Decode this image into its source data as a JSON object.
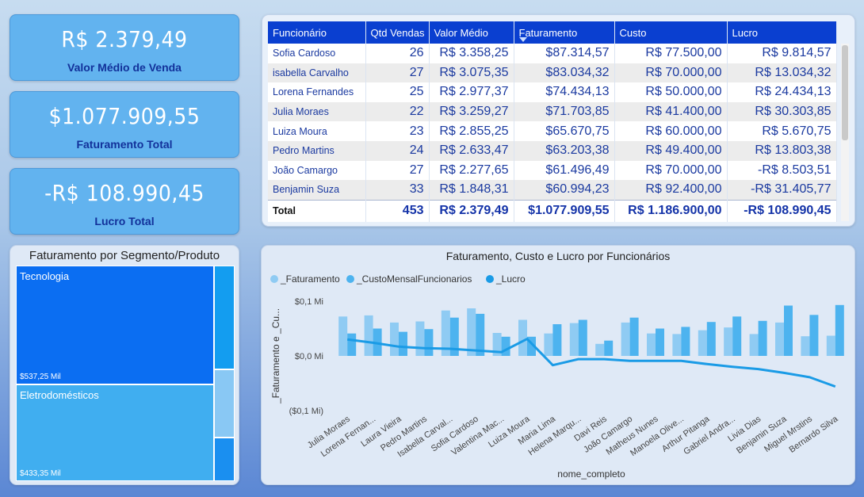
{
  "kpis": {
    "avg_sale": {
      "value": "R$ 2.379,49",
      "label": "Valor Médio de Venda"
    },
    "revenue": {
      "value": "$1.077.909,55",
      "label": "Faturamento Total"
    },
    "profit": {
      "value": "-R$ 108.990,45",
      "label": "Lucro Total"
    }
  },
  "table": {
    "columns": [
      "Funcionário",
      "Qtd Vendas",
      "Valor Médio",
      "Faturamento",
      "Custo",
      "Lucro"
    ],
    "rows": [
      [
        "Sofia Cardoso",
        "26",
        "R$ 3.358,25",
        "$87.314,57",
        "R$ 77.500,00",
        "R$ 9.814,57"
      ],
      [
        "isabella Carvalho",
        "27",
        "R$ 3.075,35",
        "$83.034,32",
        "R$ 70.000,00",
        "R$ 13.034,32"
      ],
      [
        "Lorena Fernandes",
        "25",
        "R$ 2.977,37",
        "$74.434,13",
        "R$ 50.000,00",
        "R$ 24.434,13"
      ],
      [
        "Julia Moraes",
        "22",
        "R$ 3.259,27",
        "$71.703,85",
        "R$ 41.400,00",
        "R$ 30.303,85"
      ],
      [
        "Luiza Moura",
        "23",
        "R$ 2.855,25",
        "$65.670,75",
        "R$ 60.000,00",
        "R$ 5.670,75"
      ],
      [
        "Pedro Martins",
        "24",
        "R$ 2.633,47",
        "$63.203,38",
        "R$ 49.400,00",
        "R$ 13.803,38"
      ],
      [
        "João Camargo",
        "27",
        "R$ 2.277,65",
        "$61.496,49",
        "R$ 70.000,00",
        "-R$ 8.503,51"
      ],
      [
        "Benjamin Suza",
        "33",
        "R$ 1.848,31",
        "$60.994,23",
        "R$ 92.400,00",
        "-R$ 31.405,77"
      ]
    ],
    "total": [
      "Total",
      "453",
      "R$ 2.379,49",
      "$1.077.909,55",
      "R$ 1.186.900,00",
      "-R$ 108.990,45"
    ]
  },
  "treemap": {
    "title": "Faturamento por Segmento/Produto",
    "tiles": [
      {
        "name": "Tecnologia",
        "value": "$537,25 Mil"
      },
      {
        "name": "Eletrodomésticos",
        "value": "$433,35 Mil"
      }
    ]
  },
  "chart_data": {
    "type": "bar",
    "title": "Faturamento, Custo e Lucro por Funcionários",
    "xlabel": "nome_completo",
    "ylabel": "_Faturamento e _Cu...",
    "ylim": [
      -0.1,
      0.1
    ],
    "yticks": [
      "$0,1 Mi",
      "$0,0 Mi",
      "($0,1 Mi)"
    ],
    "ytick_values": [
      0.1,
      0.0,
      -0.1
    ],
    "categories": [
      "Julia Moraes",
      "Lorena Fernan...",
      "Laura Vieira",
      "Pedro Martins",
      "Isabella Carval...",
      "Sofia Cardoso",
      "Valentina Mac...",
      "Luiza Moura",
      "Maria Lima",
      "Helena Marqu...",
      "Davi Reis",
      "João Camargo",
      "Matheus Nunes",
      "Manoela Olive...",
      "Arthur Pitanga",
      "Gabriel Andra...",
      "Livia Dias",
      "Benjamin Suza",
      "Miguel Mrstins",
      "Bernardo Silva"
    ],
    "series": [
      {
        "name": "_Faturamento",
        "type": "bar",
        "color": "#8fcbf3",
        "values": [
          0.072,
          0.074,
          0.061,
          0.063,
          0.083,
          0.087,
          0.042,
          0.066,
          0.041,
          0.06,
          0.022,
          0.061,
          0.041,
          0.04,
          0.047,
          0.052,
          0.04,
          0.061,
          0.036,
          0.037
        ]
      },
      {
        "name": "_CustoMensalFuncionarios",
        "type": "bar",
        "color": "#4db3ef",
        "values": [
          0.041,
          0.05,
          0.044,
          0.049,
          0.07,
          0.077,
          0.035,
          0.035,
          0.058,
          0.066,
          0.028,
          0.07,
          0.05,
          0.053,
          0.062,
          0.072,
          0.064,
          0.092,
          0.075,
          0.093
        ]
      },
      {
        "name": "_Lucro",
        "type": "line",
        "color": "#1a9be6",
        "values": [
          0.03,
          0.024,
          0.017,
          0.014,
          0.013,
          0.01,
          0.007,
          0.031,
          -0.017,
          -0.006,
          -0.006,
          -0.009,
          -0.009,
          -0.009,
          -0.015,
          -0.02,
          -0.024,
          -0.031,
          -0.039,
          -0.056
        ]
      }
    ],
    "legend_position": "top-left"
  }
}
